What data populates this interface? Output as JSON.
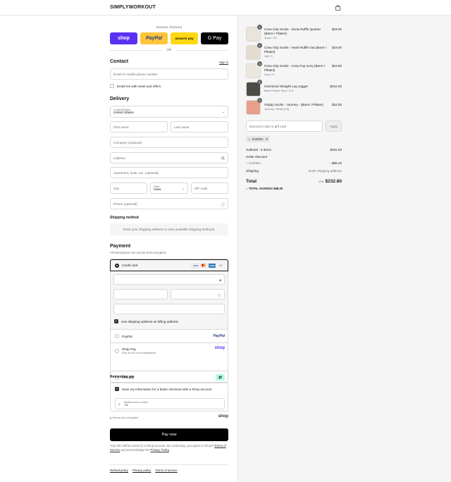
{
  "brand": "SIMPLYWORKOUT",
  "express": {
    "label": "Express checkout",
    "shop": "shop",
    "paypal": "PayPal",
    "amazon": "amazon pay",
    "gpay": "G Pay",
    "or": "OR"
  },
  "contact": {
    "title": "Contact",
    "sign_in": "Sign in",
    "email_placeholder": "Email or mobile phone number",
    "news_label": "Email me with news and offers"
  },
  "delivery": {
    "title": "Delivery",
    "country_label": "Country/Region",
    "country_value": "United States",
    "first_name": "First name",
    "last_name": "Last name",
    "company": "Company (optional)",
    "address": "Address",
    "apartment": "Apartment, suite, etc. (optional)",
    "city": "City",
    "state_label": "State",
    "state_value": "Iowa",
    "zip": "ZIP code",
    "phone": "Phone (optional)"
  },
  "shipping": {
    "title": "Shipping method",
    "message": "Enter your shipping address to view available shipping methods."
  },
  "payment": {
    "title": "Payment",
    "subtitle": "All transactions are secure and encrypted.",
    "credit_card": "Credit card",
    "card_badges": [
      "VISA",
      "MC",
      "AMEX"
    ],
    "more_cards": "+4",
    "billing_label": "Use shipping address as billing address",
    "paypal": "PayPal",
    "paypal_logo": "PayPal",
    "shop_pay": "Shop Pay",
    "shop_pay_sub": "Pay in full or in installments",
    "shop_logo": "shop",
    "afterpay": "Afterpay"
  },
  "remember": {
    "title": "Remember me",
    "save_label": "Save my information for a faster checkout with a Shop account",
    "mobile_label": "Mobile phone number",
    "mobile_value": "+1",
    "secure": "Secure and encrypted",
    "shop_logo": "shop"
  },
  "pay_now": "Pay now",
  "legal": {
    "line1": "Your info will be saved to a Shop account. By continuing, you agree to Shop's",
    "terms": "Terms of Service",
    "and": "and acknowledge the",
    "privacy": "Privacy Policy",
    "period": "."
  },
  "footer": {
    "refund": "Refund policy",
    "privacy": "Privacy policy",
    "terms": "Terms of service"
  },
  "cart": {
    "items": [
      {
        "name": "Crew Grip Socks - Snow Ruffle Quarter (Barre / Pilates)",
        "variant": "Snow / XS",
        "price": "$19.00",
        "qty": "1",
        "color": "#e9e4dc"
      },
      {
        "name": "Crew Grip Socks - Heart Ruffle Oat (Barre / Pilates)",
        "variant": "Oat / S",
        "price": "$19.00",
        "qty": "1",
        "color": "#e4dccf"
      },
      {
        "name": "Crew Grip Socks - Cozy Pup Ivory (Barre / Pilates)",
        "variant": "Ivory / S",
        "price": "$19.00",
        "qty": "1",
        "color": "#ece8df"
      },
      {
        "name": "Oversized Straight Leg Jogger",
        "variant": "Black French Terry / S-S",
        "price": "$216.00",
        "qty": "1",
        "color": "#4a4d45"
      },
      {
        "name": "Grippy Socks - Journey - (Barre / Pilates)",
        "variant": "Journey / Small (6-8)",
        "price": "$16.00",
        "qty": "1",
        "color": "#e6a08c"
      }
    ],
    "discount_placeholder": "Discount code or gift card",
    "apply": "Apply",
    "code": "KARINA",
    "subtotal_label": "Subtotal · 5 items",
    "subtotal": "$291.00",
    "order_discount": "Order discount",
    "discount_code": "KARINA",
    "discount_amount": "- $58.20",
    "shipping_label": "Shipping",
    "shipping_value": "Enter shipping address",
    "total_label": "Total",
    "currency": "USD",
    "total": "$232.80",
    "savings_label": "TOTAL SAVINGS",
    "savings": "$58.20"
  }
}
